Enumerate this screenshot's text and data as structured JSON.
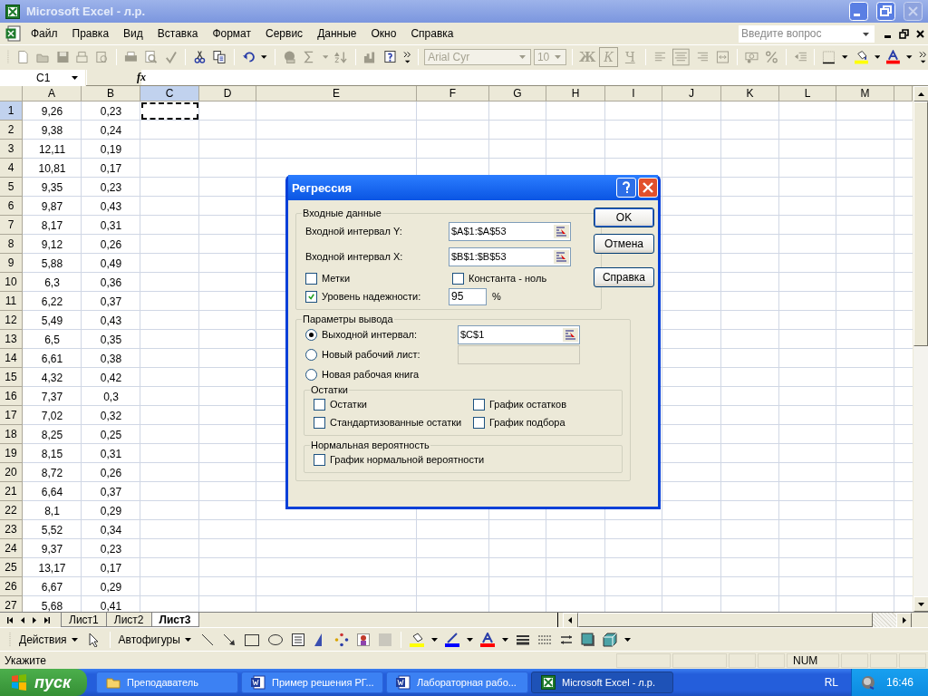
{
  "window": {
    "title": "Microsoft Excel - л.р."
  },
  "menu": [
    "Файл",
    "Правка",
    "Вид",
    "Вставка",
    "Формат",
    "Сервис",
    "Данные",
    "Окно",
    "Справка"
  ],
  "help_box": {
    "placeholder": "Введите вопрос"
  },
  "toolbar": {
    "font": "Arial Cyr",
    "size": "10",
    "format_buttons": [
      {
        "label": "Ж",
        "kind": "bold",
        "pressed": false
      },
      {
        "label": "К",
        "kind": "italic",
        "pressed": true
      },
      {
        "label": "Ч",
        "kind": "underline",
        "pressed": false
      }
    ]
  },
  "formula_bar": {
    "name_box": "C1",
    "function_label": "fx"
  },
  "grid": {
    "columns": [
      {
        "label": "A",
        "selected": false
      },
      {
        "label": "B",
        "selected": false
      },
      {
        "label": "C",
        "selected": true
      },
      {
        "label": "D",
        "selected": false
      },
      {
        "label": "E",
        "selected": false
      },
      {
        "label": "F",
        "selected": false
      },
      {
        "label": "G",
        "selected": false
      },
      {
        "label": "H",
        "selected": false
      },
      {
        "label": "I",
        "selected": false
      },
      {
        "label": "J",
        "selected": false
      },
      {
        "label": "K",
        "selected": false
      },
      {
        "label": "L",
        "selected": false
      },
      {
        "label": "M",
        "selected": false
      }
    ],
    "rows": [
      {
        "label": "1",
        "selected": true,
        "cells": [
          "9,26",
          "0,23"
        ]
      },
      {
        "label": "2",
        "selected": false,
        "cells": [
          "9,38",
          "0,24"
        ]
      },
      {
        "label": "3",
        "selected": false,
        "cells": [
          "12,11",
          "0,19"
        ]
      },
      {
        "label": "4",
        "selected": false,
        "cells": [
          "10,81",
          "0,17"
        ]
      },
      {
        "label": "5",
        "selected": false,
        "cells": [
          "9,35",
          "0,23"
        ]
      },
      {
        "label": "6",
        "selected": false,
        "cells": [
          "9,87",
          "0,43"
        ]
      },
      {
        "label": "7",
        "selected": false,
        "cells": [
          "8,17",
          "0,31"
        ]
      },
      {
        "label": "8",
        "selected": false,
        "cells": [
          "9,12",
          "0,26"
        ]
      },
      {
        "label": "9",
        "selected": false,
        "cells": [
          "5,88",
          "0,49"
        ]
      },
      {
        "label": "10",
        "selected": false,
        "cells": [
          "6,3",
          "0,36"
        ]
      },
      {
        "label": "11",
        "selected": false,
        "cells": [
          "6,22",
          "0,37"
        ]
      },
      {
        "label": "12",
        "selected": false,
        "cells": [
          "5,49",
          "0,43"
        ]
      },
      {
        "label": "13",
        "selected": false,
        "cells": [
          "6,5",
          "0,35"
        ]
      },
      {
        "label": "14",
        "selected": false,
        "cells": [
          "6,61",
          "0,38"
        ]
      },
      {
        "label": "15",
        "selected": false,
        "cells": [
          "4,32",
          "0,42"
        ]
      },
      {
        "label": "16",
        "selected": false,
        "cells": [
          "7,37",
          "0,3"
        ]
      },
      {
        "label": "17",
        "selected": false,
        "cells": [
          "7,02",
          "0,32"
        ]
      },
      {
        "label": "18",
        "selected": false,
        "cells": [
          "8,25",
          "0,25"
        ]
      },
      {
        "label": "19",
        "selected": false,
        "cells": [
          "8,15",
          "0,31"
        ]
      },
      {
        "label": "20",
        "selected": false,
        "cells": [
          "8,72",
          "0,26"
        ]
      },
      {
        "label": "21",
        "selected": false,
        "cells": [
          "6,64",
          "0,37"
        ]
      },
      {
        "label": "22",
        "selected": false,
        "cells": [
          "8,1",
          "0,29"
        ]
      },
      {
        "label": "23",
        "selected": false,
        "cells": [
          "5,52",
          "0,34"
        ]
      },
      {
        "label": "24",
        "selected": false,
        "cells": [
          "9,37",
          "0,23"
        ]
      },
      {
        "label": "25",
        "selected": false,
        "cells": [
          "13,17",
          "0,17"
        ]
      },
      {
        "label": "26",
        "selected": false,
        "cells": [
          "6,67",
          "0,29"
        ]
      },
      {
        "label": "27",
        "selected": false,
        "cells": [
          "5,68",
          "0,41"
        ]
      }
    ]
  },
  "sheet_tabs": [
    {
      "label": "Лист1",
      "selected": false
    },
    {
      "label": "Лист2",
      "selected": false
    },
    {
      "label": "Лист3",
      "selected": true
    }
  ],
  "drawing_toolbar": {
    "actions": "Действия",
    "autoshapes": "Автофигуры"
  },
  "status_bar": {
    "text": "Укажите",
    "indicator": "NUM"
  },
  "dialog": {
    "title": "Регрессия",
    "input": {
      "legend": "Входные данные",
      "fields": [
        {
          "label": "Входной интервал Y:",
          "value": "$A$1:$A$53"
        },
        {
          "label": "Входной интервал X:",
          "value": "$B$1:$B$53"
        }
      ],
      "options": [
        {
          "label": "Метки",
          "checked": false
        },
        {
          "label": "Константа - ноль",
          "checked": false
        },
        {
          "label": "Уровень надежности:",
          "checked": true,
          "value": "95",
          "unit": "%"
        }
      ]
    },
    "output": {
      "legend": "Параметры вывода",
      "choices": [
        {
          "label": "Выходной интервал:",
          "selected": true,
          "value": "$C$1"
        },
        {
          "label": "Новый рабочий лист:",
          "selected": false,
          "has_field": true
        },
        {
          "label": "Новая рабочая книга",
          "selected": false
        }
      ]
    },
    "residuals": {
      "legend": "Остатки",
      "options": [
        {
          "label": "Остатки",
          "checked": false
        },
        {
          "label": "График остатков",
          "checked": false
        },
        {
          "label": "Стандартизованные остатки",
          "checked": false
        },
        {
          "label": "График подбора",
          "checked": false
        }
      ]
    },
    "normal": {
      "legend": "Нормальная вероятность",
      "options": [
        {
          "label": "График нормальной вероятности",
          "checked": false
        }
      ]
    },
    "buttons": [
      {
        "label": "OK",
        "default": true
      },
      {
        "label": "Отмена",
        "default": false
      },
      {
        "label": "Справка",
        "default": false
      }
    ]
  },
  "taskbar": {
    "start": "пуск",
    "tasks": [
      {
        "label": "Преподаватель",
        "kind": "folder",
        "selected": false
      },
      {
        "label": "Пример решения РГ...",
        "kind": "word",
        "selected": false
      },
      {
        "label": "Лабораторная рабо...",
        "kind": "word",
        "selected": false
      },
      {
        "label": "Microsoft Excel - л.р.",
        "kind": "excel",
        "selected": true
      }
    ],
    "language": "RL",
    "clock": "16:46"
  }
}
